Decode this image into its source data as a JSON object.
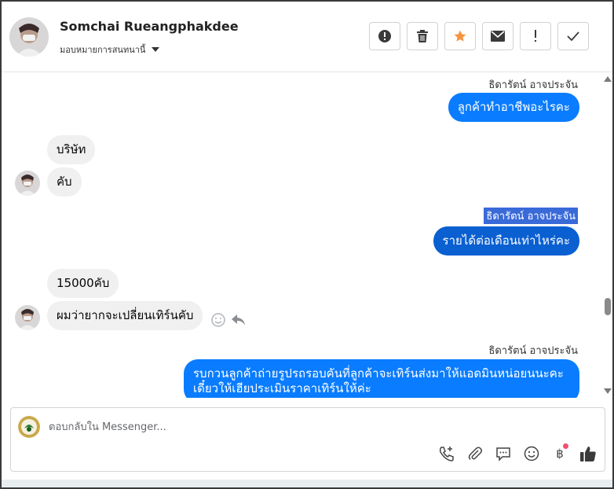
{
  "header": {
    "contact_name": "Somchai Rueangphakdee",
    "assign_label": "มอบหมายการสนทนานี้"
  },
  "toolbar": {
    "buttons": [
      {
        "name": "spam-button",
        "icon": "alert-circle-icon"
      },
      {
        "name": "delete-button",
        "icon": "trash-icon"
      },
      {
        "name": "star-button",
        "icon": "star-icon",
        "color": "#f7923b"
      },
      {
        "name": "email-button",
        "icon": "envelope-icon"
      },
      {
        "name": "mark-unread-button",
        "icon": "exclamation-icon"
      },
      {
        "name": "mark-done-button",
        "icon": "check-icon"
      }
    ]
  },
  "conversation": {
    "messages": [
      {
        "direction": "out",
        "sender": "ธิดารัตน์ อาจประจัน",
        "text": "ลูกค้าทำอาชีพอะไรคะ"
      },
      {
        "direction": "in",
        "text": "บริษัท"
      },
      {
        "direction": "in",
        "text": "คับ"
      },
      {
        "direction": "out",
        "sender": "ธิดารัตน์ อาจประจัน",
        "text": "รายได้ต่อเดือนเท่าไหร่คะ",
        "sender_selected": true
      },
      {
        "direction": "in",
        "text": "15000คับ"
      },
      {
        "direction": "in",
        "text": "ผมว่ายากจะเปลี่ยนเทิร์นคับ"
      },
      {
        "direction": "out",
        "sender": "ธิดารัตน์ อาจประจัน",
        "text_line1": "รบกวนลูกค้าถ่ายรูปรถรอบคันที่ลูกค้าจะเทิร์นส่งมาให้แอดมินหน่อยนนะคะ",
        "text_line2": "เดี๋ยวให้เฮียประเมินราคาเทิร์นให้ค่ะ"
      }
    ]
  },
  "composer": {
    "placeholder": "ตอบกลับใน Messenger..."
  },
  "colors": {
    "outgoing_bubble": "#0a7cff",
    "incoming_bubble": "#f0f0f0",
    "star": "#f7923b",
    "notification_dot": "#f0506e"
  }
}
